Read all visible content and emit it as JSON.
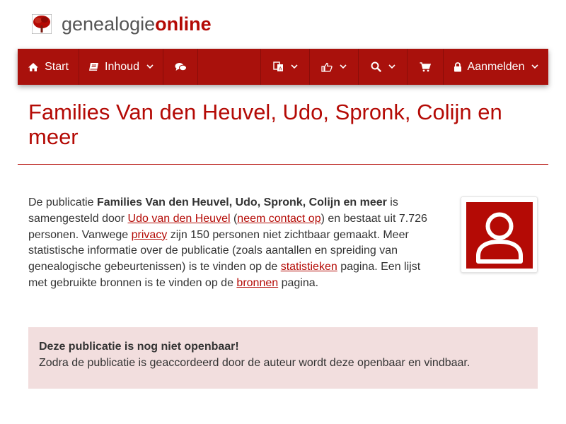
{
  "brand": {
    "name_regular": "genealogie",
    "name_strong": "online",
    "tree_icon": "tree-icon",
    "accent_color": "#b40a05",
    "nav_color": "#a9110c"
  },
  "nav": {
    "start": {
      "icon": "home-icon",
      "label": "Start"
    },
    "contents": {
      "icon": "book-icon",
      "label": "Inhoud"
    },
    "chat": {
      "icon": "comments-icon"
    },
    "language": {
      "icon": "translate-icon"
    },
    "social": {
      "icon": "thumbs-up-icon"
    },
    "search": {
      "icon": "search-icon"
    },
    "cart": {
      "icon": "cart-icon"
    },
    "login": {
      "icon": "lock-icon",
      "label": "Aanmelden"
    }
  },
  "page": {
    "title": "Families Van den Heuvel, Udo, Spronk, Colijn en meer"
  },
  "intro": {
    "t1": "De publicatie ",
    "publication": "Families Van den Heuvel, Udo, Spronk, Colijn en meer",
    "t2": " is samengesteld door ",
    "author": "Udo van den Heuvel",
    "t3": " (",
    "contact": "neem contact op",
    "t4": ") en bestaat uit 7.726 personen. Vanwege ",
    "privacy": "privacy",
    "t5": " zijn 150 personen niet zichtbaar gemaakt. Meer statistische informatie over de publicatie (zoals aantallen en spreiding van genealogische gebeurtenissen) is te vinden op de ",
    "statistics": "statistieken",
    "t6": " pagina. Een lijst met gebruikte bronnen is te vinden op de ",
    "sources": "bronnen",
    "t7": " pagina."
  },
  "alert": {
    "title": "Deze publicatie is nog niet openbaar!",
    "body": "Zodra de publicatie is geaccordeerd door de auteur wordt deze openbaar en vindbaar.",
    "background": "#f2dede"
  }
}
